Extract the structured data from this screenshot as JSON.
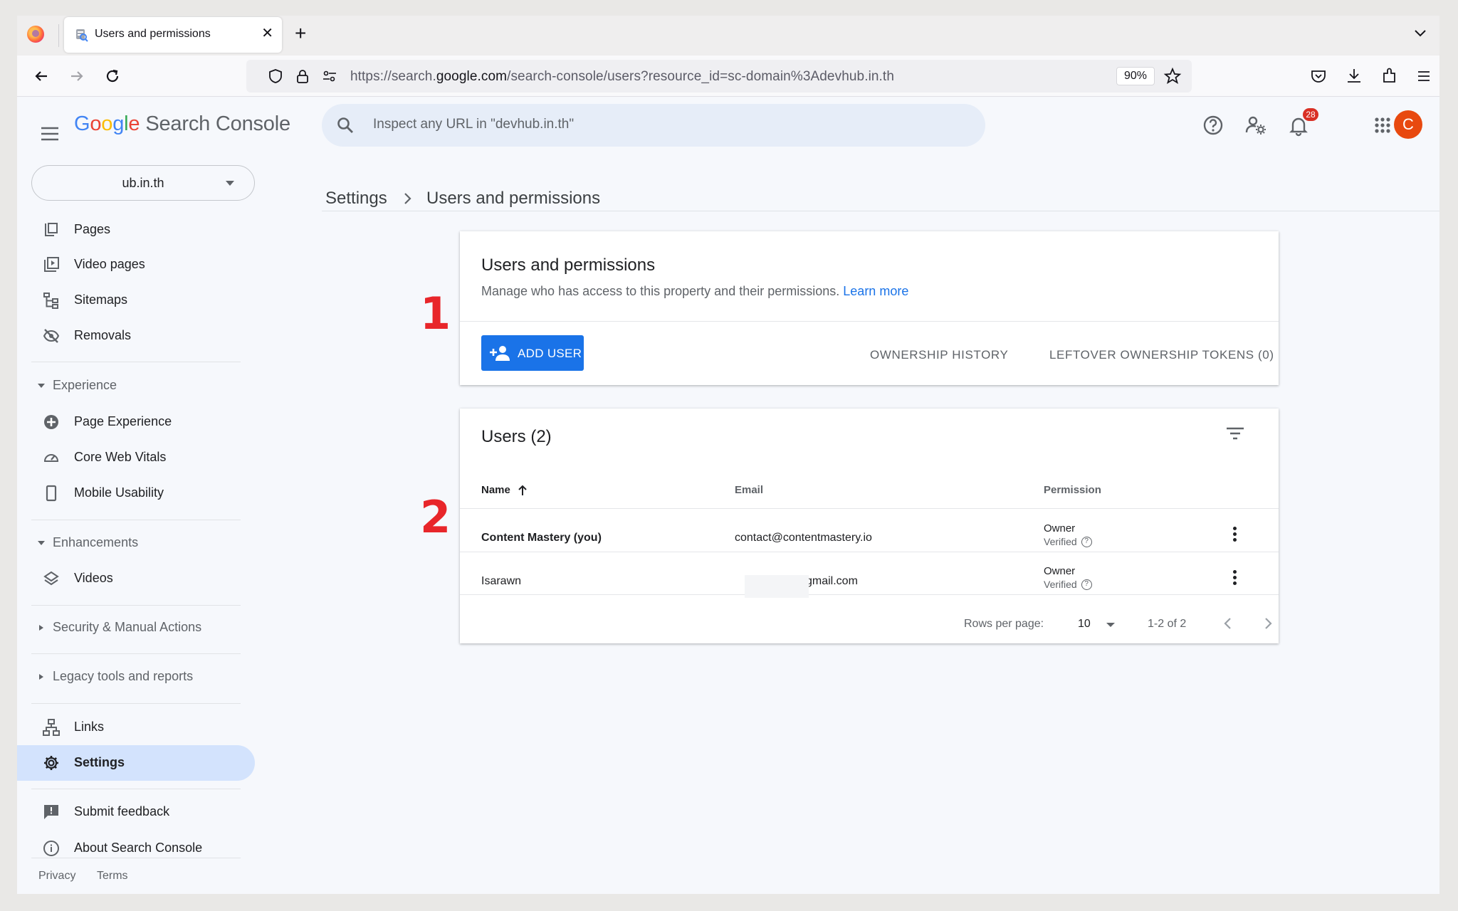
{
  "browser": {
    "tab_title": "Users and permissions",
    "url_prefix": "https://search.",
    "url_domain": "google.com",
    "url_path": "/search-console/users?resource_id=sc-domain%3Adevhub.in.th",
    "zoom": "90%"
  },
  "header": {
    "logo_letters": [
      "G",
      "o",
      "o",
      "g",
      "l",
      "e"
    ],
    "logo_product": "Search Console",
    "search_placeholder": "Inspect any URL in \"devhub.in.th\"",
    "notification_count": "28",
    "avatar_letter": "C"
  },
  "sidebar": {
    "property": "ub.in.th",
    "items_top": [
      {
        "label": "Pages",
        "icon": "pages-icon"
      },
      {
        "label": "Video pages",
        "icon": "video-pages-icon"
      },
      {
        "label": "Sitemaps",
        "icon": "sitemaps-icon"
      },
      {
        "label": "Removals",
        "icon": "removals-icon"
      }
    ],
    "experience": {
      "label": "Experience",
      "items": [
        {
          "label": "Page Experience",
          "icon": "page-experience-icon"
        },
        {
          "label": "Core Web Vitals",
          "icon": "core-web-vitals-icon"
        },
        {
          "label": "Mobile Usability",
          "icon": "mobile-icon"
        }
      ]
    },
    "enhancements": {
      "label": "Enhancements",
      "items": [
        {
          "label": "Videos",
          "icon": "videos-icon"
        }
      ]
    },
    "security": {
      "label": "Security & Manual Actions"
    },
    "legacy": {
      "label": "Legacy tools and reports"
    },
    "items_bottom": [
      {
        "label": "Links",
        "icon": "links-icon"
      },
      {
        "label": "Settings",
        "icon": "gear-icon"
      }
    ],
    "feedback": {
      "label": "Submit feedback",
      "icon": "feedback-icon"
    },
    "about": {
      "label": "About Search Console",
      "icon": "info-icon"
    },
    "footer": {
      "privacy": "Privacy",
      "terms": "Terms"
    }
  },
  "breadcrumb": {
    "parent": "Settings",
    "current": "Users and permissions"
  },
  "permissions_card": {
    "title": "Users and permissions",
    "description": "Manage who has access to this property and their permissions.",
    "learn_more": "Learn more",
    "add_user": "ADD USER",
    "ownership_history": "OWNERSHIP HISTORY",
    "leftover_tokens": "LEFTOVER OWNERSHIP TOKENS (0)"
  },
  "users_card": {
    "title": "Users (2)",
    "columns": {
      "name": "Name",
      "email": "Email",
      "permission": "Permission"
    },
    "rows": [
      {
        "name": "Content Mastery (you)",
        "email": "contact@contentmastery.io",
        "permission": "Owner",
        "status": "Verified"
      },
      {
        "name": "Isarawn",
        "email": "gmail.com",
        "permission": "Owner",
        "status": "Verified"
      }
    ],
    "rows_per_page_label": "Rows per page:",
    "rows_per_page": "10",
    "range": "1-2 of 2"
  },
  "annotations": [
    "1",
    "2"
  ]
}
